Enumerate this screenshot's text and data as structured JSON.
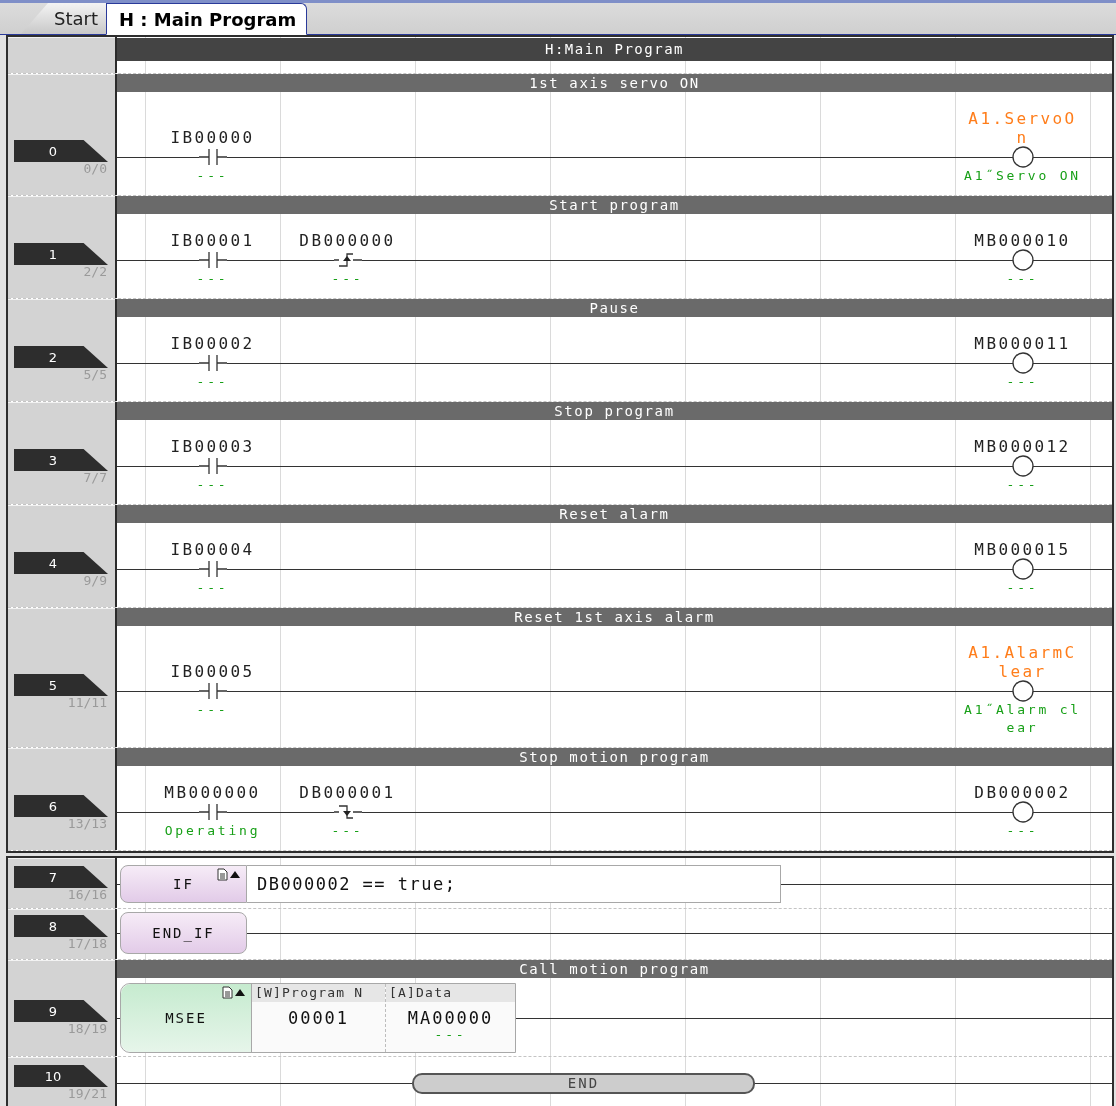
{
  "tabs": [
    {
      "label": "Start",
      "selected": false
    },
    {
      "label": "H : Main Program",
      "selected": true
    }
  ],
  "program_title": "H:Main Program",
  "panels": [
    {
      "rungs": [
        {
          "number": "0",
          "steps": "0/0",
          "comment": "1st axis servo ON",
          "kind": "ladder",
          "inputs": [
            {
              "kind": "contact",
              "address": "IB00000",
              "comment": "---"
            }
          ],
          "coil": {
            "address": "A1.ServoOn",
            "labeled": true,
            "comment": "A1˝Servo ON"
          }
        },
        {
          "number": "1",
          "steps": "2/2",
          "comment": "Start program",
          "kind": "ladder",
          "inputs": [
            {
              "kind": "contact",
              "address": "IB00001",
              "comment": "---"
            },
            {
              "kind": "rising-edge",
              "address": "DB000000",
              "comment": "---"
            }
          ],
          "coil": {
            "address": "MB000010",
            "labeled": false,
            "comment": "---"
          }
        },
        {
          "number": "2",
          "steps": "5/5",
          "comment": "Pause",
          "kind": "ladder",
          "inputs": [
            {
              "kind": "contact",
              "address": "IB00002",
              "comment": "---"
            }
          ],
          "coil": {
            "address": "MB000011",
            "labeled": false,
            "comment": "---"
          }
        },
        {
          "number": "3",
          "steps": "7/7",
          "comment": "Stop program",
          "kind": "ladder",
          "inputs": [
            {
              "kind": "contact",
              "address": "IB00003",
              "comment": "---"
            }
          ],
          "coil": {
            "address": "MB000012",
            "labeled": false,
            "comment": "---"
          }
        },
        {
          "number": "4",
          "steps": "9/9",
          "comment": "Reset alarm",
          "kind": "ladder",
          "inputs": [
            {
              "kind": "contact",
              "address": "IB00004",
              "comment": "---"
            }
          ],
          "coil": {
            "address": "MB000015",
            "labeled": false,
            "comment": "---"
          }
        },
        {
          "number": "5",
          "steps": "11/11",
          "comment": "Reset 1st axis alarm",
          "kind": "ladder",
          "inputs": [
            {
              "kind": "contact",
              "address": "IB00005",
              "comment": "---"
            }
          ],
          "coil": {
            "address": "A1.AlarmClear",
            "labeled": true,
            "comment": "A1˝Alarm clear"
          }
        },
        {
          "number": "6",
          "steps": "13/13",
          "comment": "Stop motion program",
          "kind": "ladder",
          "inputs": [
            {
              "kind": "contact",
              "address": "MB000000",
              "comment": "Operating"
            },
            {
              "kind": "falling-edge",
              "address": "DB000001",
              "comment": "---"
            }
          ],
          "coil": {
            "address": "DB000002",
            "labeled": false,
            "comment": "---"
          }
        }
      ]
    },
    {
      "rungs": [
        {
          "number": "7",
          "steps": "16/16",
          "kind": "if",
          "instruction": "IF",
          "expression": "DB000002 == true;"
        },
        {
          "number": "8",
          "steps": "17/18",
          "kind": "end-if",
          "instruction": "END_IF"
        },
        {
          "number": "9",
          "steps": "18/19",
          "comment": "Call motion program",
          "kind": "function",
          "instruction": "MSEE",
          "parameters": [
            {
              "header": "[W]Program N",
              "value": "00001"
            },
            {
              "header": "[A]Data",
              "value": "MA00000",
              "comment": "---"
            }
          ]
        },
        {
          "number": "10",
          "steps": "19/21",
          "kind": "end",
          "instruction": "END"
        }
      ]
    }
  ]
}
